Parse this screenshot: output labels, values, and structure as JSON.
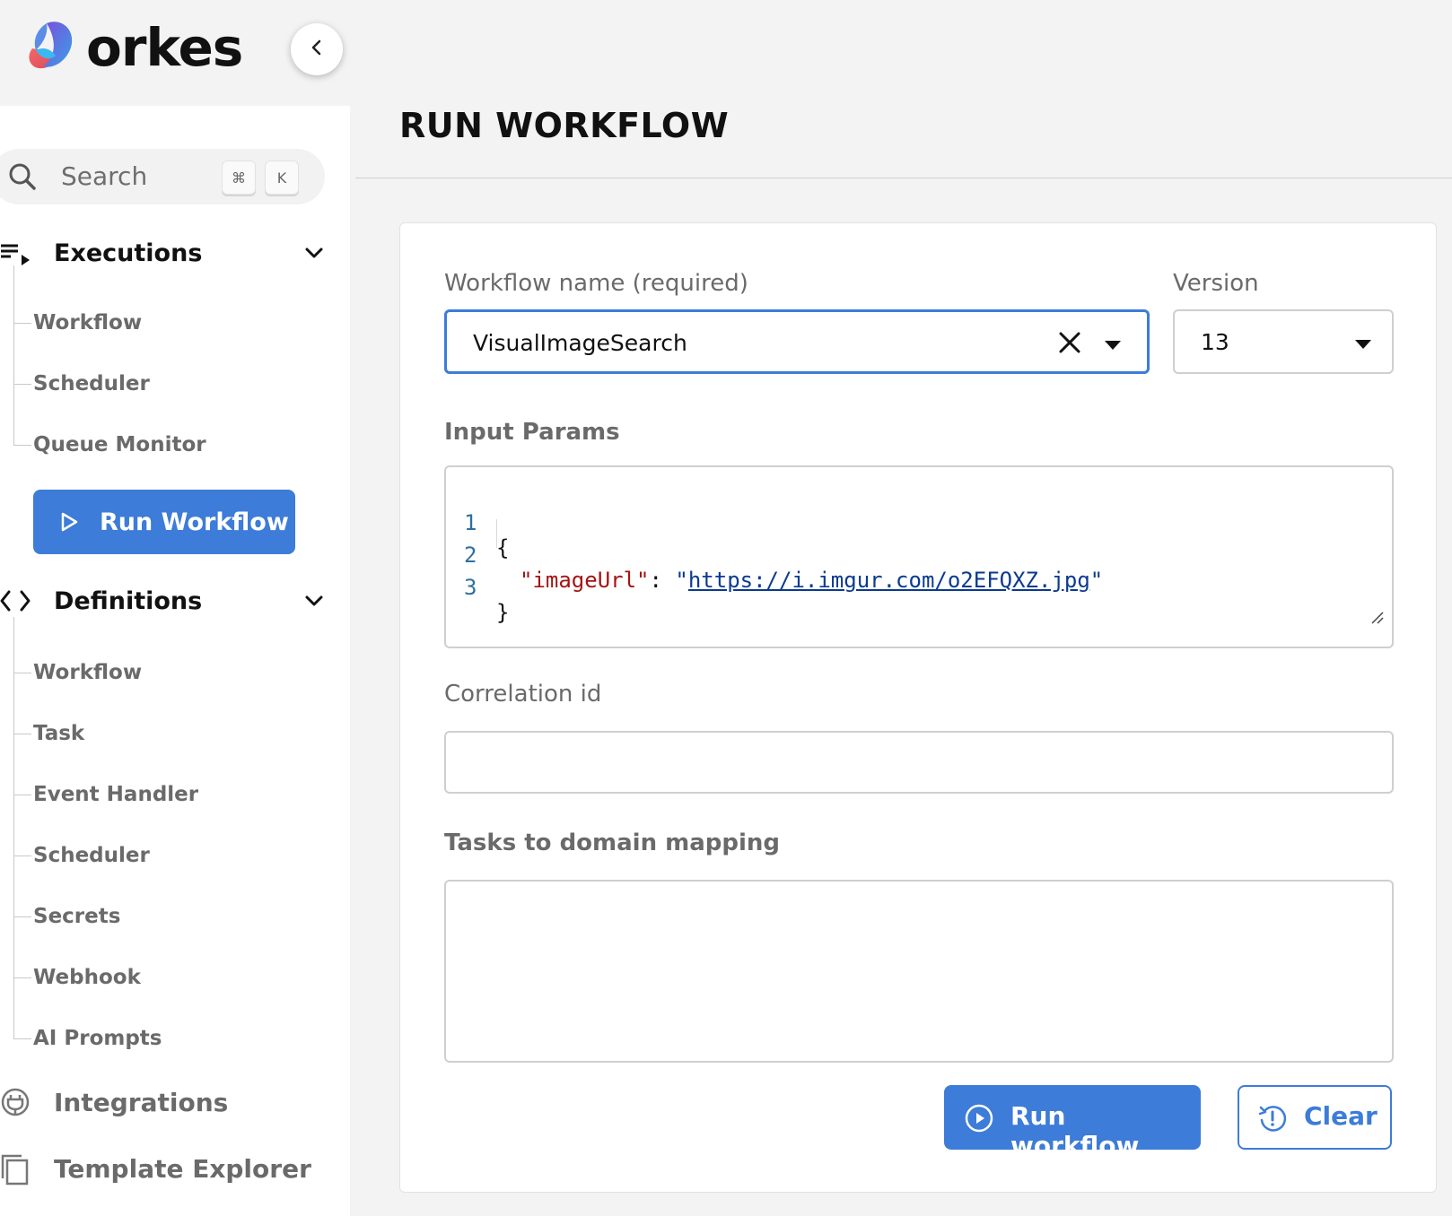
{
  "brand": {
    "name": "orkes"
  },
  "sidebar": {
    "search": {
      "placeholder": "Search",
      "shortcut_mod": "⌘",
      "shortcut_key": "K"
    },
    "executions": {
      "title": "Executions",
      "items": [
        "Workflow",
        "Scheduler",
        "Queue Monitor"
      ]
    },
    "run_workflow_label": "Run Workflow",
    "definitions": {
      "title": "Definitions",
      "items": [
        "Workflow",
        "Task",
        "Event Handler",
        "Scheduler",
        "Secrets",
        "Webhook",
        "AI Prompts"
      ]
    },
    "bottom_items": [
      "Integrations",
      "Template Explorer"
    ]
  },
  "main": {
    "title": "RUN WORKFLOW",
    "workflow_name": {
      "label": "Workflow name (required)",
      "value": "VisualImageSearch"
    },
    "version": {
      "label": "Version",
      "value": "13"
    },
    "input_params": {
      "label": "Input Params",
      "lines": [
        {
          "no": "1",
          "open": "{"
        },
        {
          "no": "2",
          "key": "\"imageUrl\"",
          "colon": ": ",
          "q1": "\"",
          "url": "https://i.imgur.com/o2EFQXZ.jpg",
          "q2": "\""
        },
        {
          "no": "3",
          "close": "}"
        }
      ]
    },
    "correlation_id": {
      "label": "Correlation id",
      "value": ""
    },
    "tasks_to_domain": {
      "label": "Tasks to domain mapping",
      "value": ""
    },
    "run_button": "Run workflow",
    "clear_button": "Clear"
  },
  "colors": {
    "accent": "#3d7cd8",
    "sidebar_bg": "#ffffff",
    "page_bg": "#f3f3f3"
  }
}
